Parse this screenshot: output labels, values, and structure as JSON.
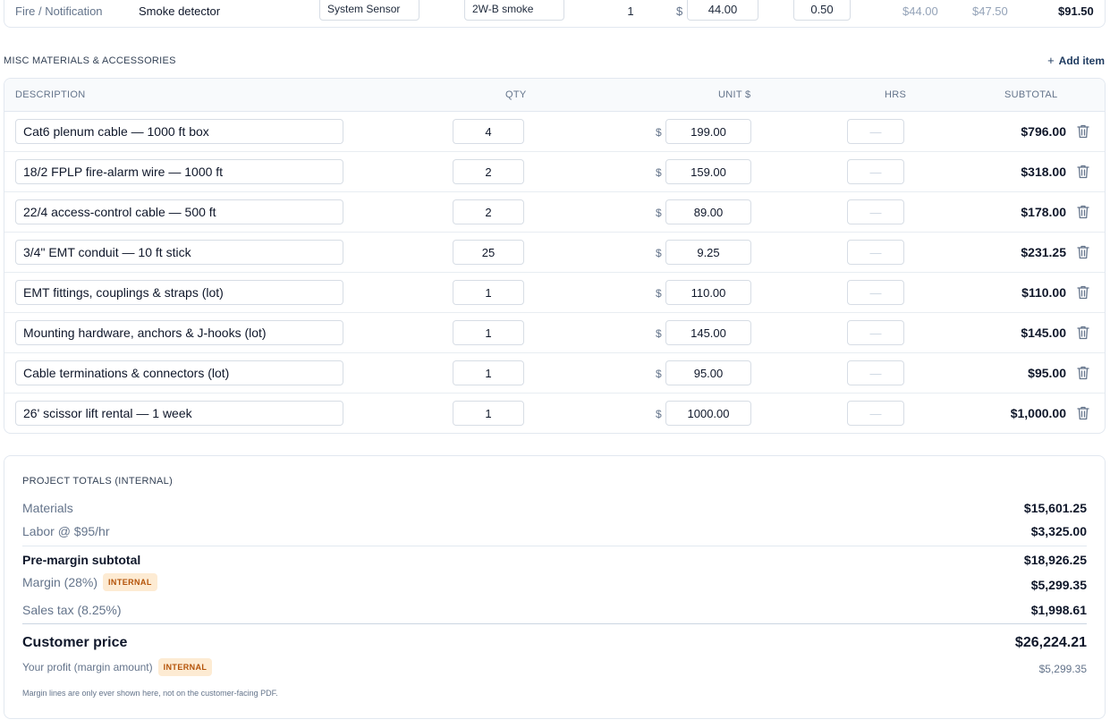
{
  "top_row": {
    "category": "Fire / Notification",
    "name": "Smoke detector",
    "manufacturer": "System Sensor",
    "model": "2W-B smoke",
    "qty": "1",
    "currency": "$",
    "unit_price": "44.00",
    "hours": "0.50",
    "ext_material": "$44.00",
    "ext_labor": "$47.50",
    "subtotal": "$91.50"
  },
  "misc": {
    "title": "MISC MATERIALS & ACCESSORIES",
    "add_label": "Add item",
    "add_icon": "plus-icon",
    "columns": {
      "description": "DESCRIPTION",
      "qty": "QTY",
      "unit": "UNIT $",
      "hrs": "HRS",
      "subtotal": "SUBTOTAL"
    },
    "currency": "$",
    "hrs_placeholder": "—",
    "delete_icon": "trash-icon",
    "items": [
      {
        "description": "Cat6 plenum cable — 1000 ft box",
        "qty": "4",
        "unit": "199.00",
        "subtotal": "$796.00"
      },
      {
        "description": "18/2 FPLP fire-alarm wire — 1000 ft",
        "qty": "2",
        "unit": "159.00",
        "subtotal": "$318.00"
      },
      {
        "description": "22/4 access-control cable — 500 ft",
        "qty": "2",
        "unit": "89.00",
        "subtotal": "$178.00"
      },
      {
        "description": "3/4\" EMT conduit — 10 ft stick",
        "qty": "25",
        "unit": "9.25",
        "subtotal": "$231.25"
      },
      {
        "description": "EMT fittings, couplings & straps (lot)",
        "qty": "1",
        "unit": "110.00",
        "subtotal": "$110.00"
      },
      {
        "description": "Mounting hardware, anchors & J-hooks (lot)",
        "qty": "1",
        "unit": "145.00",
        "subtotal": "$145.00"
      },
      {
        "description": "Cable terminations & connectors (lot)",
        "qty": "1",
        "unit": "95.00",
        "subtotal": "$95.00"
      },
      {
        "description": "26' scissor lift rental — 1 week",
        "qty": "1",
        "unit": "1000.00",
        "subtotal": "$1,000.00"
      }
    ]
  },
  "totals": {
    "title": "PROJECT TOTALS (INTERNAL)",
    "materials_label": "Materials",
    "materials_value": "$15,601.25",
    "labor_label": "Labor @ $95/hr",
    "labor_value": "$3,325.00",
    "premargin_label": "Pre-margin subtotal",
    "premargin_value": "$18,926.25",
    "margin_label": "Margin (28%)",
    "margin_value": "$5,299.35",
    "tax_label": "Sales tax (8.25%)",
    "tax_value": "$1,998.61",
    "customer_label": "Customer price",
    "customer_value": "$26,224.21",
    "profit_label": "Your profit (margin amount)",
    "profit_value": "$5,299.35",
    "badge": "INTERNAL",
    "footnote": "Margin lines are only ever shown here, not on the customer-facing PDF."
  },
  "colors": {
    "accent": "#1e3a5f",
    "badge_bg": "#fdebd3",
    "badge_text": "#b45309"
  }
}
